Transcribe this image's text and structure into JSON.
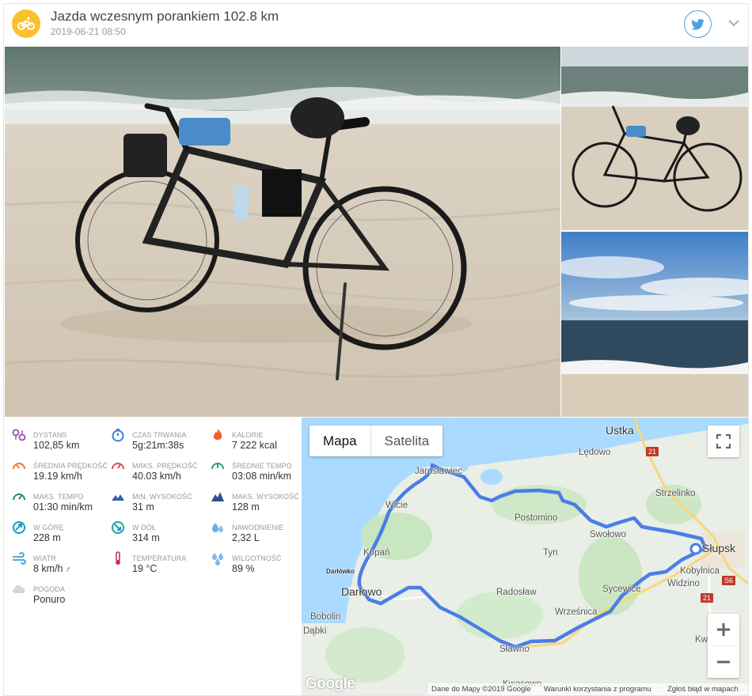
{
  "activity": {
    "title": "Jazda wczesnym porankiem 102.8 km",
    "date": "2019-06-21 08:50"
  },
  "colors": {
    "accent": "#fbc02d",
    "route": "#4a7de8",
    "twitter": "#4ea0e6"
  },
  "icons": {
    "sport": "bike-icon",
    "share": "twitter-icon",
    "menu": "chevron-down-icon"
  },
  "stats": [
    {
      "label": "DYSTANS",
      "value": "102,85 km",
      "icon": "distance-icon"
    },
    {
      "label": "CZAS TRWANIA",
      "value": "5g:21m:38s",
      "icon": "stopwatch-icon"
    },
    {
      "label": "KALORIE",
      "value": "7 222 kcal",
      "icon": "fire-icon"
    },
    {
      "label": "ŚREDNIA PRĘDKOŚĆ",
      "value": "19.19 km/h",
      "icon": "speedometer-icon"
    },
    {
      "label": "MAKS. PRĘDKOŚĆ",
      "value": "40.03 km/h",
      "icon": "speedometer-max-icon"
    },
    {
      "label": "ŚREDNIE TEMPO",
      "value": "03:08 min/km",
      "icon": "pace-icon"
    },
    {
      "label": "MAKS. TEMPO",
      "value": "01:30 min/km",
      "icon": "pace-max-icon"
    },
    {
      "label": "MIN. WYSOKOŚĆ",
      "value": "31 m",
      "icon": "mountain-min-icon"
    },
    {
      "label": "MAKS. WYSOKOŚĆ",
      "value": "128 m",
      "icon": "mountain-max-icon"
    },
    {
      "label": "W GÓRĘ",
      "value": "228 m",
      "icon": "ascent-icon"
    },
    {
      "label": "W DÓŁ",
      "value": "314 m",
      "icon": "descent-icon"
    },
    {
      "label": "NAWODNIENIE",
      "value": "2,32 L",
      "icon": "drops-icon"
    },
    {
      "label": "WIATR",
      "value": "8 km/h",
      "icon": "wind-icon"
    },
    {
      "label": "TEMPERATURA",
      "value": "19 °C",
      "icon": "thermometer-icon"
    },
    {
      "label": "WILGOTNOŚĆ",
      "value": "89 %",
      "icon": "humidity-icon"
    },
    {
      "label": "POGODA",
      "value": "Ponuro",
      "icon": "cloud-icon"
    }
  ],
  "map": {
    "tabs": [
      "Mapa",
      "Satelita"
    ],
    "towns": [
      "Ustka",
      "Lędowo",
      "Jarosławiec",
      "Strzelinko",
      "Wicie",
      "Postomino",
      "Sławno",
      "Słupsk",
      "Swołowo",
      "Kopań",
      "Tyn",
      "Kobylnica",
      "Darłówko",
      "Darłowo",
      "Radosław",
      "Sycewice",
      "Widzino",
      "Bobolin",
      "Wrześnica",
      "Dąbki",
      "Kwasowo",
      "Kw"
    ],
    "roads": [
      "21",
      "S6"
    ],
    "logo": "Google",
    "footer": {
      "data": "Dane do Mapy ©2019 Google",
      "terms": "Warunki korzystania z programu",
      "report": "Zgłoś błąd w mapach"
    }
  }
}
